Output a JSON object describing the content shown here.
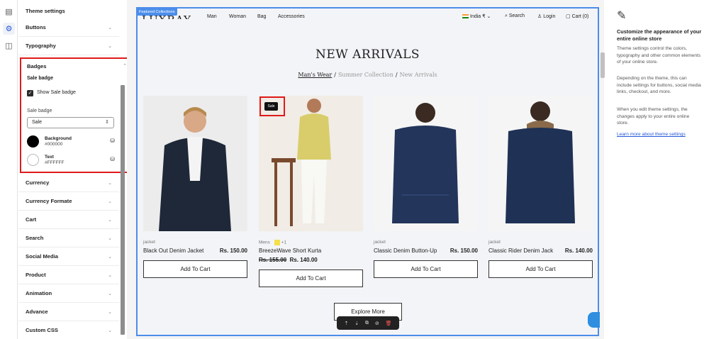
{
  "rail": {
    "icons": [
      "layout-icon",
      "gear-icon",
      "apps-icon"
    ]
  },
  "settings": {
    "title": "Theme settings",
    "sections_top": [
      {
        "label": "Buttons"
      },
      {
        "label": "Typography"
      }
    ],
    "badges": {
      "label": "Badges",
      "subheading": "Sale badge",
      "checkbox_label": "Show Sale badge",
      "checkbox_checked": true,
      "select_label": "Sale badge",
      "select_value": "Sale",
      "background": {
        "name": "Background",
        "hex": "#000000"
      },
      "text": {
        "name": "Text",
        "hex": "#FFFFFF"
      }
    },
    "sections_bottom": [
      {
        "label": "Currency"
      },
      {
        "label": "Currency Formate"
      },
      {
        "label": "Cart"
      },
      {
        "label": "Search"
      },
      {
        "label": "Social Media"
      },
      {
        "label": "Product"
      },
      {
        "label": "Animation"
      },
      {
        "label": "Advance"
      },
      {
        "label": "Custom CSS"
      }
    ]
  },
  "preview": {
    "tag": "Featured Collections",
    "logo": "LUXRAY",
    "nav": [
      "Man",
      "Woman",
      "Bag",
      "Accessories"
    ],
    "region": "India ₹",
    "search": "Search",
    "login": "Login",
    "cart": "Cart (0)",
    "heading": "NEW ARRIVALS",
    "breadcrumb": {
      "current": "Man's Wear",
      "mid": "Summer Collection",
      "last": "New Arrivals",
      "sep": "/"
    },
    "products": [
      {
        "type": "jacket",
        "name": "Black Out Denim Jacket",
        "price": "Rs. 150.00",
        "button": "Add To Cart"
      },
      {
        "type": "Mens",
        "swatch_more": "+1",
        "name": "BreezeWave Short Kurta",
        "old_price": "Rs. 155.00",
        "price": "Rs. 140.00",
        "button": "Add To Cart",
        "badge": "Sale"
      },
      {
        "type": "jacket",
        "name": "Classic Denim Button-Up",
        "price": "Rs. 150.00",
        "button": "Add To Cart"
      },
      {
        "type": "jacket",
        "name": "Classic Rider Denim Jack",
        "price": "Rs. 140.00",
        "button": "Add To Cart"
      }
    ],
    "explore": "Explore More"
  },
  "help": {
    "title": "Customize the appearance of your entire online store",
    "p1": "Theme settings control the colors, typography and other common elements of your online store.",
    "p2": "Depending on the theme, this can include settings for buttons, social media links, checkout, and more.",
    "p3": "When you edit theme settings, the changes apply to your entire online store.",
    "link": "Learn more about theme settings"
  }
}
